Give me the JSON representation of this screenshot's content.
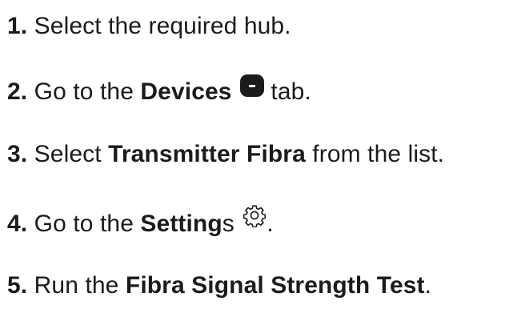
{
  "steps": [
    {
      "number": "1.",
      "parts": [
        "Select the required hub."
      ]
    },
    {
      "number": "2.",
      "parts": [
        "Go to the ",
        "Devices",
        " tab."
      ],
      "icon": "devices-icon"
    },
    {
      "number": "3.",
      "parts": [
        "Select ",
        "Transmitter Fibra",
        " from the list."
      ]
    },
    {
      "number": "4.",
      "parts": [
        "Go to the ",
        "Setting",
        "s",
        "."
      ],
      "icon": "gear-icon"
    },
    {
      "number": "5.",
      "parts": [
        "Run the ",
        "Fibra Signal Strength Test",
        "."
      ]
    }
  ]
}
